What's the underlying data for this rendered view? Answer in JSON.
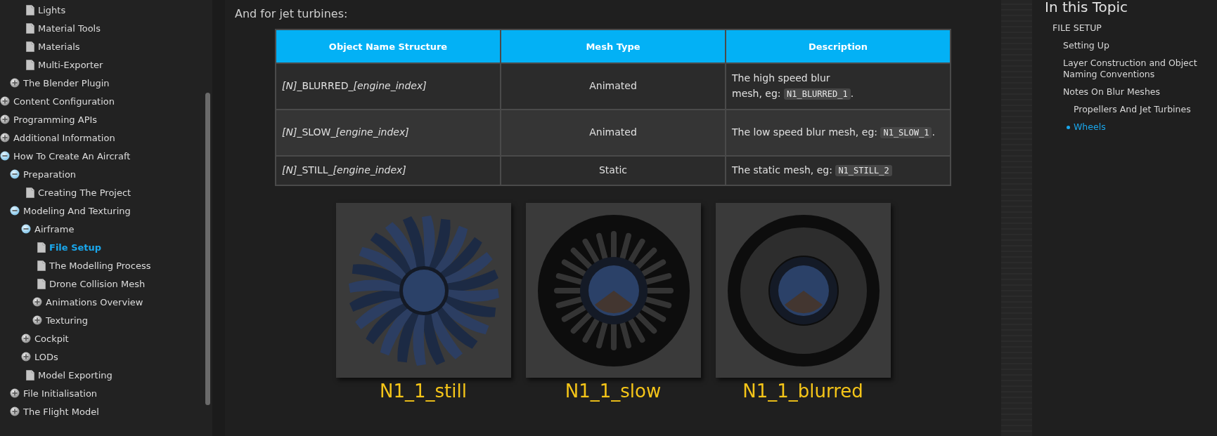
{
  "sidebar": {
    "tree": [
      {
        "kind": "group",
        "children": [
          {
            "kind": "group",
            "children": [
              {
                "kind": "page",
                "label": "Lights",
                "selected": false
              },
              {
                "kind": "page",
                "label": "Material Tools",
                "selected": false
              },
              {
                "kind": "page",
                "label": "Materials",
                "selected": false
              },
              {
                "kind": "page",
                "label": "Multi-Exporter",
                "selected": false
              }
            ]
          },
          {
            "kind": "folder",
            "label": "The Blender Plugin",
            "expanded": false,
            "selected": false
          }
        ]
      },
      {
        "kind": "folder",
        "label": "Content Configuration",
        "expanded": false,
        "selected": false
      },
      {
        "kind": "folder",
        "label": "Programming APIs",
        "expanded": false,
        "selected": false
      },
      {
        "kind": "folder",
        "label": "Additional Information",
        "expanded": false,
        "selected": false
      },
      {
        "kind": "folder",
        "label": "How To Create An Aircraft",
        "expanded": true,
        "selected": false,
        "children": [
          {
            "kind": "folder",
            "label": "Preparation",
            "expanded": true,
            "selected": false,
            "children": [
              {
                "kind": "page",
                "label": "Creating The Project",
                "selected": false
              }
            ]
          },
          {
            "kind": "folder",
            "label": "Modeling And Texturing",
            "expanded": true,
            "selected": false,
            "children": [
              {
                "kind": "folder",
                "label": "Airframe",
                "expanded": true,
                "selected": false,
                "children": [
                  {
                    "kind": "page",
                    "label": "File Setup",
                    "selected": true
                  },
                  {
                    "kind": "page",
                    "label": "The Modelling Process",
                    "selected": false
                  },
                  {
                    "kind": "page",
                    "label": "Drone Collision Mesh",
                    "selected": false
                  },
                  {
                    "kind": "folder",
                    "label": "Animations Overview",
                    "expanded": false,
                    "selected": false
                  },
                  {
                    "kind": "folder",
                    "label": "Texturing",
                    "expanded": false,
                    "selected": false
                  }
                ]
              },
              {
                "kind": "folder",
                "label": "Cockpit",
                "expanded": false,
                "selected": false
              },
              {
                "kind": "folder",
                "label": "LODs",
                "expanded": false,
                "selected": false
              },
              {
                "kind": "page",
                "label": "Model Exporting",
                "selected": false
              }
            ]
          },
          {
            "kind": "folder",
            "label": "File Initialisation",
            "expanded": false,
            "selected": false
          },
          {
            "kind": "folder",
            "label": "The Flight Model",
            "expanded": false,
            "selected": false
          }
        ]
      }
    ]
  },
  "content": {
    "heading": "And for jet turbines:",
    "table": {
      "columns": [
        "Object Name Structure",
        "Mesh Type",
        "Description"
      ],
      "rows": [
        {
          "name": [
            {
              "kind": "italic",
              "text": "[N]"
            },
            {
              "kind": "plain",
              "text": "_BLURRED_"
            },
            {
              "kind": "italic",
              "text": "[engine_index]"
            }
          ],
          "mesh_type": "Animated",
          "description": [
            {
              "kind": "text",
              "text": "The high speed blur mesh, eg:"
            },
            {
              "kind": "code",
              "text": "N1_BLURRED_1"
            },
            {
              "kind": "text",
              "text": "."
            }
          ]
        },
        {
          "name": [
            {
              "kind": "italic",
              "text": "[N]"
            },
            {
              "kind": "plain",
              "text": "_SLOW_"
            },
            {
              "kind": "italic",
              "text": "[engine_index]"
            }
          ],
          "mesh_type": "Animated",
          "description": [
            {
              "kind": "text",
              "text": "The low speed blur mesh, eg:"
            },
            {
              "kind": "code",
              "text": "N1_SLOW_1"
            },
            {
              "kind": "text",
              "text": "."
            }
          ]
        },
        {
          "name": [
            {
              "kind": "italic",
              "text": "[N]"
            },
            {
              "kind": "plain",
              "text": "_STILL_"
            },
            {
              "kind": "italic",
              "text": "[engine_index]"
            }
          ],
          "mesh_type": "Static",
          "description": [
            {
              "kind": "text",
              "text": "The static mesh, eg:"
            },
            {
              "kind": "code",
              "text": "N1_STILL_2"
            }
          ]
        }
      ]
    },
    "figures": [
      {
        "kind": "still",
        "caption": "N1_1_still"
      },
      {
        "kind": "slow",
        "caption": "N1_1_slow"
      },
      {
        "kind": "blurred",
        "caption": "N1_1_blurred"
      }
    ]
  },
  "topic_panel": {
    "title": "In this Topic",
    "items": [
      {
        "label": "FILE SETUP",
        "selected": false,
        "children": [
          {
            "label": "Setting Up",
            "selected": false
          },
          {
            "label": "Layer Construction and Object Naming Conventions",
            "selected": false
          },
          {
            "label": "Notes On Blur Meshes",
            "selected": false,
            "children": [
              {
                "label": "Propellers And Jet Turbines",
                "selected": false
              },
              {
                "label": "Wheels",
                "selected": true
              }
            ]
          }
        ]
      }
    ]
  }
}
